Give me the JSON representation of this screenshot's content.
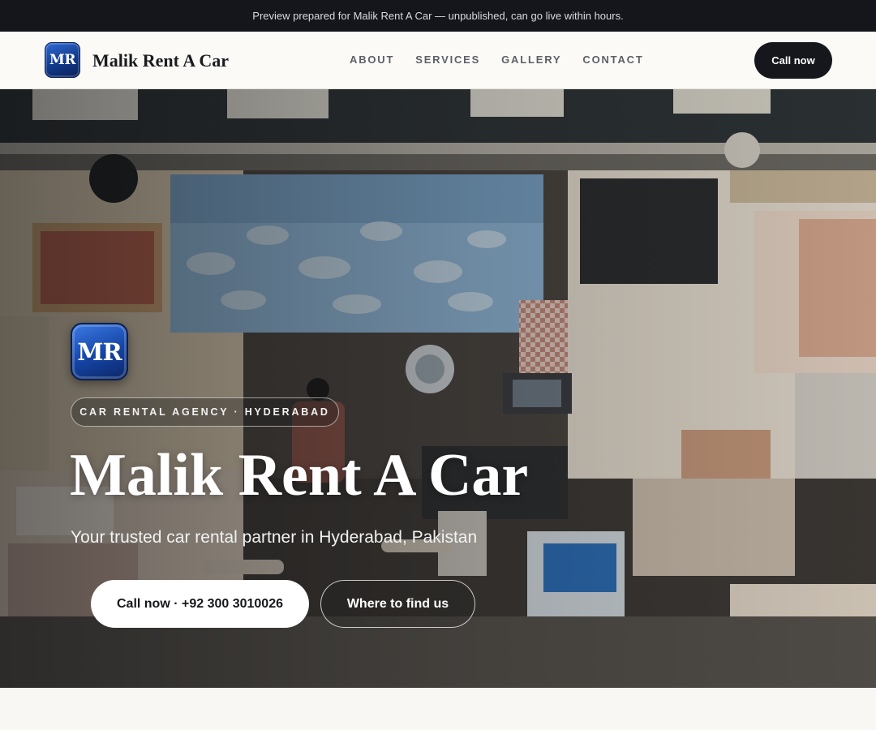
{
  "banner": {
    "text": "Preview prepared for Malik Rent A Car — unpublished, can go live within hours."
  },
  "header": {
    "logo_text": "MR",
    "brand": "Malik Rent A Car",
    "nav": [
      {
        "label": "ABOUT"
      },
      {
        "label": "SERVICES"
      },
      {
        "label": "GALLERY"
      },
      {
        "label": "CONTACT"
      }
    ],
    "cta_label": "Call now"
  },
  "hero": {
    "logo_text": "MR",
    "tag": "CAR RENTAL AGENCY · HYDERABAD",
    "title": "Malik Rent A Car",
    "subtitle": "Your trusted car rental partner in Hyderabad, Pakistan",
    "primary_button": "Call now · +92 300 3010026",
    "secondary_button": "Where to find us"
  },
  "colors": {
    "banner_bg": "#14161b",
    "nav_bg": "#fbfaf7",
    "accent_dark": "#15171c",
    "logo_blue": "#1444a3"
  }
}
